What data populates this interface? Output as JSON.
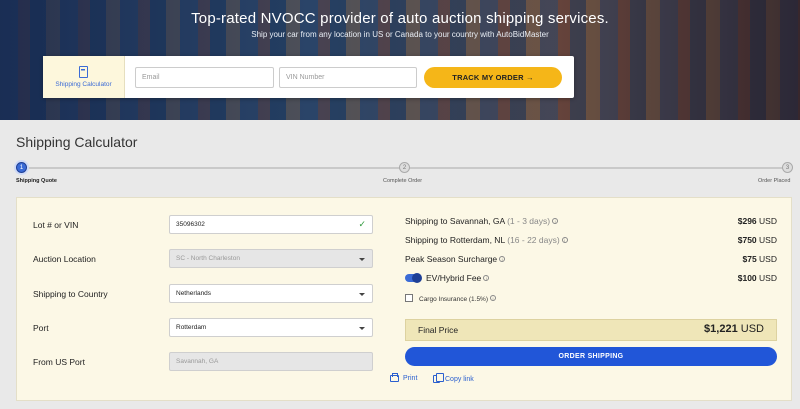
{
  "hero": {
    "title": "Top-rated NVOCC provider of auto auction shipping services.",
    "subtitle": "Ship your car from any location in US or Canada to your country with AutoBidMaster"
  },
  "track_bar": {
    "calc_tab_label": "Shipping Calculator",
    "email_placeholder": "Email",
    "vin_placeholder": "VIN Number",
    "track_button": "TRACK MY ORDER →"
  },
  "page_title": "Shipping Calculator",
  "stepper": {
    "steps": [
      {
        "number": "1",
        "label": "Shipping Quote",
        "active": true
      },
      {
        "number": "2",
        "label": "Complete Order",
        "active": false
      },
      {
        "number": "3",
        "label": "Order Placed",
        "active": false
      }
    ]
  },
  "form": {
    "lot_label": "Lot # or VIN",
    "lot_value": "35096302",
    "auction_label": "Auction Location",
    "auction_value": "SC - North Charleston",
    "country_label": "Shipping to Country",
    "country_value": "Netherlands",
    "port_label": "Port",
    "port_value": "Rotterdam",
    "from_port_label": "From US Port",
    "from_port_value": "Savannah, GA"
  },
  "costs": {
    "savannah_label": "Shipping to Savannah, GA",
    "savannah_days": "(1 - 3 days)",
    "savannah_amount": "$296",
    "rotterdam_label": "Shipping to Rotterdam, NL",
    "rotterdam_days": "(16 - 22 days)",
    "rotterdam_amount": "$750",
    "peak_label": "Peak Season Surcharge",
    "peak_amount": "$75",
    "ev_label": "EV/Hybrid Fee",
    "ev_amount": "$100",
    "cargo_label": "Cargo Insurance (1.5%)",
    "currency": "USD"
  },
  "final": {
    "label": "Final Price",
    "amount": "$1,221",
    "currency": "USD"
  },
  "actions": {
    "order_button": "ORDER SHIPPING",
    "print": "Print",
    "copy_link": "Copy link"
  },
  "colors": {
    "accent_blue": "#2156d8",
    "track_yellow": "#f5b618",
    "card_bg": "#fcf8e6"
  }
}
